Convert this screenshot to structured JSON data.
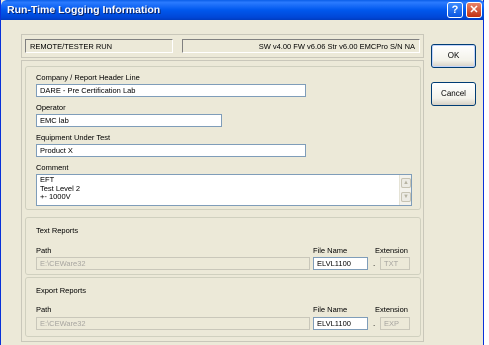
{
  "window": {
    "title": "Run-Time Logging Information"
  },
  "titlebar_buttons": {
    "help": "?",
    "close": "✕"
  },
  "status": {
    "mode": "REMOTE/TESTER RUN",
    "versions": "SW v4.00  FW v6.06  Str v6.00  EMCPro  S/N NA"
  },
  "buttons": {
    "ok": "OK",
    "cancel": "Cancel"
  },
  "header_group": {
    "company_label": "Company / Report Header Line",
    "company_value": "DARE - Pre Certification Lab",
    "operator_label": "Operator",
    "operator_value": "EMC lab",
    "eut_label": "Equipment Under Test",
    "eut_value": "Product X",
    "comment_label": "Comment",
    "comment_lines": [
      "EFT",
      "Test Level 2",
      "+- 1000V"
    ]
  },
  "text_reports": {
    "title": "Text Reports",
    "path_label": "Path",
    "path_value": "E:\\CEWare32",
    "filename_label": "File Name",
    "filename_value": "ELVL1100",
    "extension_label": "Extension",
    "extension_value": "TXT"
  },
  "export_reports": {
    "title": "Export Reports",
    "path_label": "Path",
    "path_value": "E:\\CEWare32",
    "filename_label": "File Name",
    "filename_value": "ELVL1100",
    "extension_label": "Extension",
    "extension_value": "EXP"
  },
  "scroll_icons": {
    "up": "up-arrow-icon",
    "down": "down-arrow-icon"
  },
  "colors": {
    "titlebar": "#0058ee",
    "face": "#ece9d8",
    "close": "#c3300f"
  }
}
